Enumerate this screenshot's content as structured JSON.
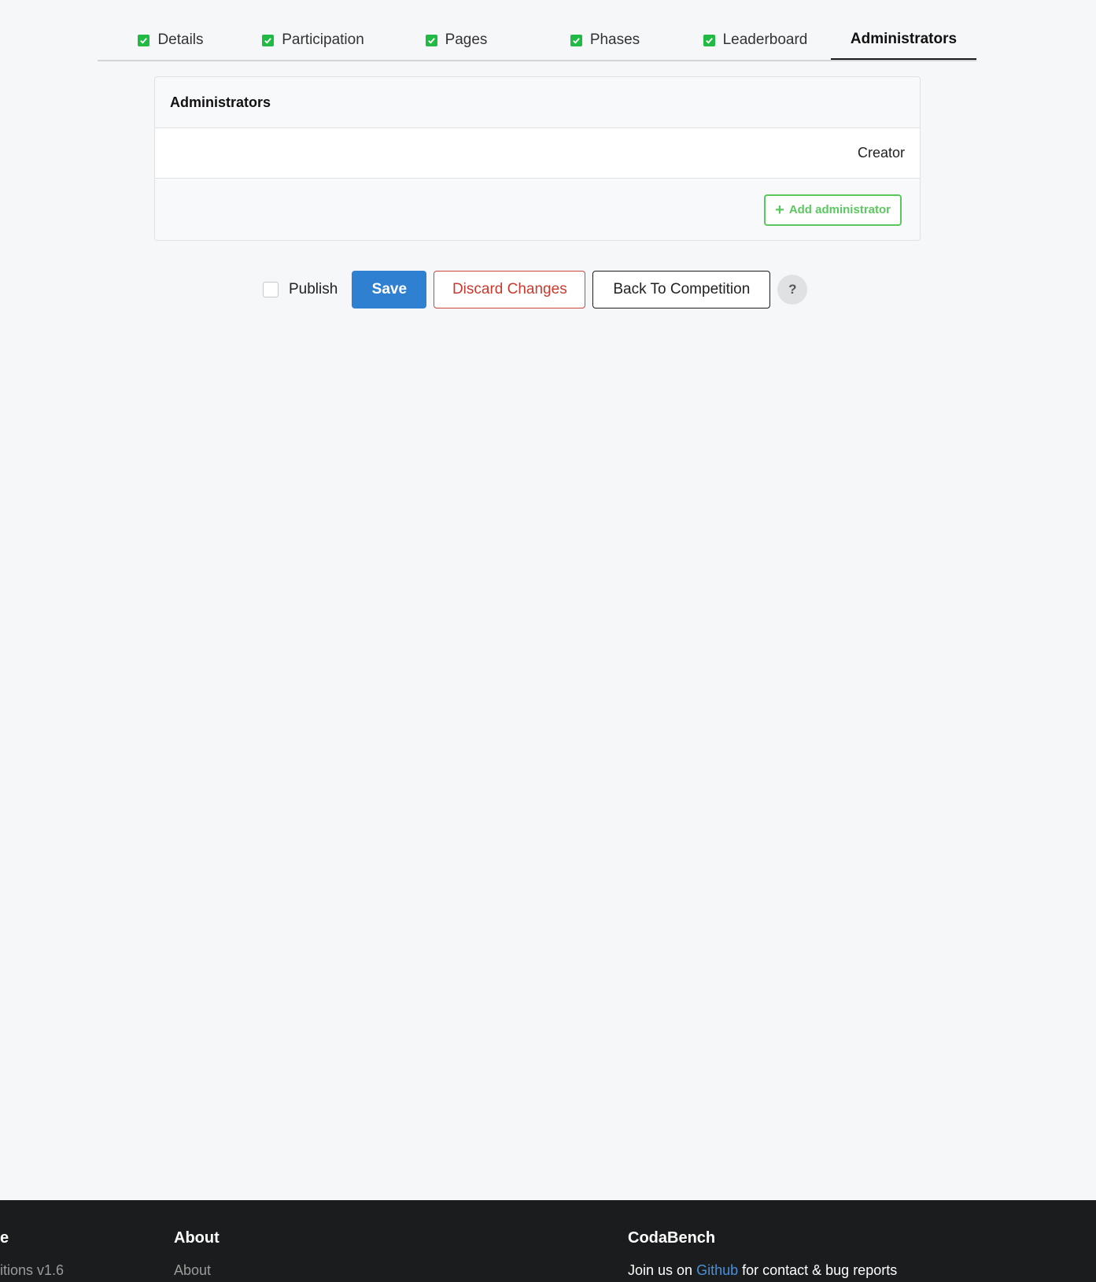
{
  "tabs": [
    {
      "label": "Details",
      "done": true
    },
    {
      "label": "Participation",
      "done": true
    },
    {
      "label": "Pages",
      "done": true
    },
    {
      "label": "Phases",
      "done": true
    },
    {
      "label": "Leaderboard",
      "done": true
    },
    {
      "label": "Administrators",
      "done": false,
      "active": true
    }
  ],
  "panel": {
    "title": "Administrators",
    "row_role": "Creator",
    "add_button": "Add administrator"
  },
  "actions": {
    "publish_label": "Publish",
    "publish_checked": false,
    "save": "Save",
    "discard": "Discard Changes",
    "back": "Back To Competition",
    "help": "?"
  },
  "footer": {
    "col1_head": "e",
    "col1_sub": "itions v1.6",
    "col2_head": "About",
    "col2_sub": "About",
    "col3_head": "CodaBench",
    "join_prefix": "Join us on ",
    "join_link": "Github",
    "join_suffix": " for contact & bug reports"
  },
  "colors": {
    "primary": "#2f80d1",
    "success": "#21ba45",
    "danger": "#c83a2e",
    "footer_bg": "#1b1c1d"
  }
}
